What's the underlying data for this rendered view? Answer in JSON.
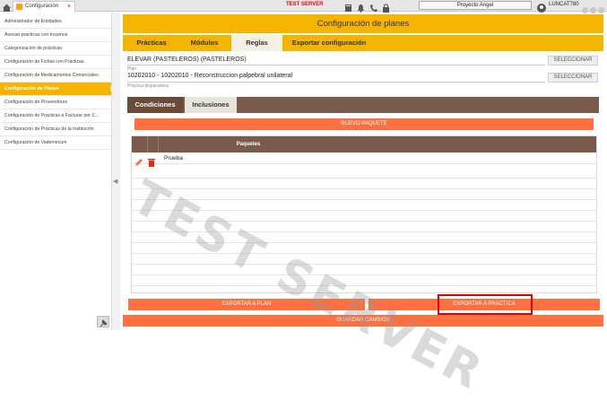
{
  "topbar": {
    "tab_label": "Configuración",
    "tab_close": "×",
    "test_server": "TEST SERVER",
    "project": "Proyecto Angel",
    "user": "LUNCAT780"
  },
  "sidebar": {
    "items": [
      "Administrador de Entidades",
      "Asociar practicas con Insumos",
      "Categorización de prácticas",
      "Configuración de Fichas con Prácticas",
      "Configuración de Medicamentos Comerciales",
      "Configuración de Planes",
      "Configuración de Proveedores",
      "Configuración de Prácticas a Facturar por C...",
      "Configuración de Prácticas de la Institución",
      "Configuración de Vademecum"
    ],
    "active_index": 5
  },
  "main": {
    "title": "Configuración de planes",
    "tabs": [
      "Prácticas",
      "Módulos",
      "Reglas",
      "Exportar configuración"
    ],
    "active_tab": "Reglas",
    "entity_value": "ELEVAR (PASTELEROS) (PASTELEROS)",
    "plan_label": "Plan",
    "plan_value": "10202010 - 10202010 - Reconstruccion palpebral unilateral",
    "practice_label": "Práctica disparadora",
    "select_label": "SELECCIONAR",
    "panel_tabs": [
      "Condiciones",
      "Inclusiones"
    ],
    "new_package_button": "NUEVO PAQUETE",
    "table_header": "Paquetes",
    "rows": [
      "Prueba"
    ],
    "export_plan_button": "EXPORTAR A PLAN",
    "export_practice_button": "EXPORTAR A PRÁCTICA",
    "save_button": "GUARDAR CAMBIOS"
  },
  "watermark": "TEST SERVER",
  "colors": {
    "accent": "#f5b400",
    "button": "#ff6f3f",
    "panel": "#7a5a4a",
    "highlight": "#e00000"
  }
}
